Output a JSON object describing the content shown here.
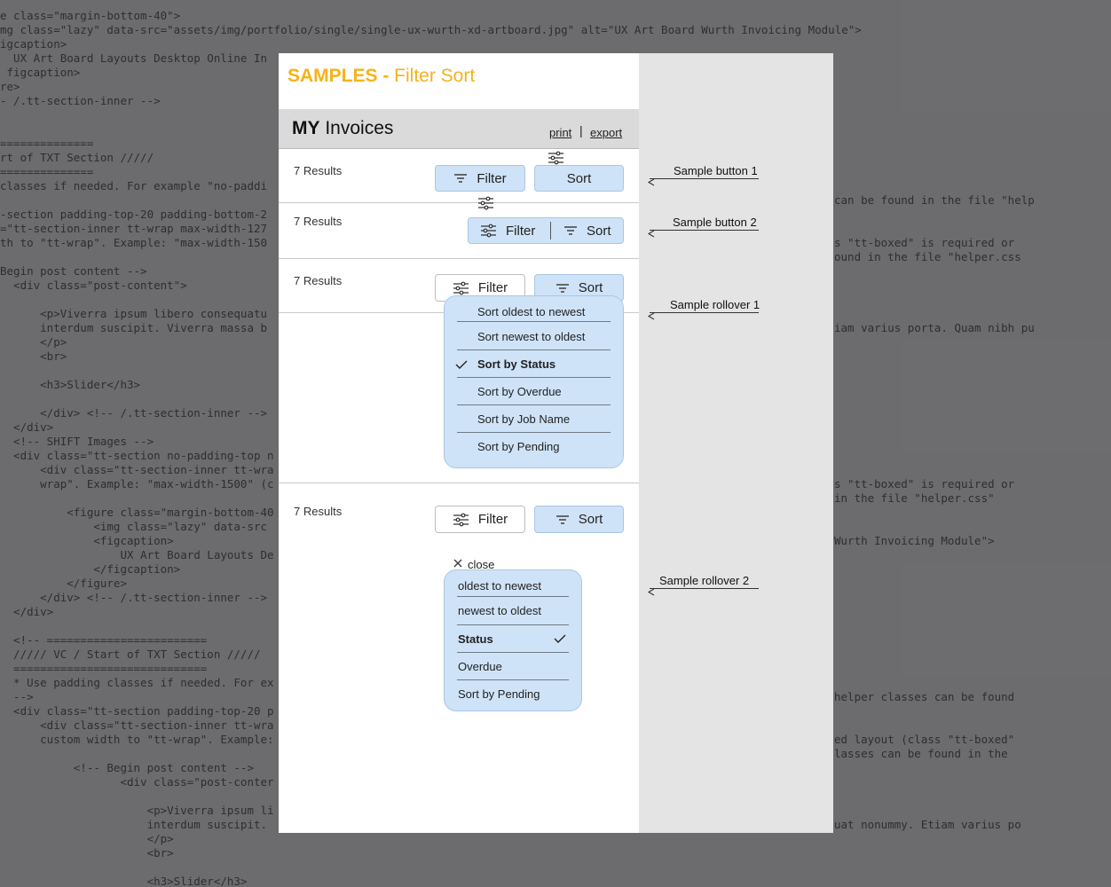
{
  "background_code": [
    "e class=\"margin-bottom-40\">",
    "mg class=\"lazy\" data-src=\"assets/img/portfolio/single/single-ux-wurth-xd-artboard.jpg\" alt=\"UX Art Board Wurth Invoicing Module\">",
    "igcaption>",
    "  UX Art Board Layouts Desktop Online In",
    " figcaption>",
    "re>",
    "- /.tt-section-inner -->",
    "",
    "",
    "==============",
    "rt of TXT Section /////",
    "==============",
    "classes if needed. For example \"no-paddi",
    "",
    "-section padding-top-20 padding-bottom-2",
    "=\"tt-section-inner tt-wrap max-width-127",
    "th to \"tt-wrap\". Example: \"max-width-150",
    "",
    "Begin post content -->",
    "  <div class=\"post-content\">",
    "",
    "      <p>Viverra ipsum libero consequatu",
    "      interdum suscipit. Viverra massa b",
    "      </p>",
    "      <br>",
    "",
    "      <h3>Slider</h3>",
    "",
    "      </div> <!-- /.tt-section-inner -->",
    "  </div>",
    "  <!-- SHIFT Images -->",
    "  <div class=\"tt-section no-padding-top n",
    "      <div class=\"tt-section-inner tt-wra",
    "      wrap\". Example: \"max-width-1500\" (c",
    "",
    "          <figure class=\"margin-bottom-40",
    "              <img class=\"lazy\" data-src",
    "              <figcaption>",
    "                  UX Art Board Layouts De",
    "              </figcaption>",
    "          </figure>",
    "      </div> <!-- /.tt-section-inner -->",
    "  </div>",
    "",
    "  <!-- ========================",
    "  ///// VC / Start of TXT Section /////",
    "  =============================",
    "  * Use padding classes if needed. For ex",
    "  -->",
    "  <div class=\"tt-section padding-top-20 p",
    "      <div class=\"tt-section-inner tt-wra",
    "      custom width to \"tt-wrap\". Example:",
    "",
    "           <!-- Begin post content -->",
    "                  <div class=\"post-conter",
    "",
    "                      <p>Viverra ipsum li",
    "                      interdum suscipit.",
    "                      </p>",
    "                      <br>",
    "",
    "                      <h3>Slider</h3>"
  ],
  "background_code_right": [
    {
      "row": 13,
      "text": "can be found in the file \"help"
    },
    {
      "row": 16,
      "text": "s \"tt-boxed\" is required or"
    },
    {
      "row": 17,
      "text": "ound in the file \"helper.css"
    },
    {
      "row": 22,
      "text": "iam varius porta. Quam nibh pu"
    },
    {
      "row": 33,
      "text": "s \"tt-boxed\" is required or"
    },
    {
      "row": 34,
      "text": "in the file \"helper.css\""
    },
    {
      "row": 37,
      "text": "Wurth Invoicing Module\">"
    },
    {
      "row": 48,
      "text": "helper classes can be found"
    },
    {
      "row": 51,
      "text": "ed layout (class \"tt-boxed\""
    },
    {
      "row": 52,
      "text": "lasses can be found in the"
    },
    {
      "row": 57,
      "text": "uat nonummy. Etiam varius po"
    }
  ],
  "title": {
    "bold": "SAMPLES -",
    "rest": " Filter Sort"
  },
  "header": {
    "bold": "MY",
    "rest": " Invoices",
    "print": "print",
    "divider": "|",
    "export": "export"
  },
  "results_label": "7 Results",
  "buttons": {
    "filter": "Filter",
    "sort": "Sort"
  },
  "rollover1": {
    "items": [
      "Sort oldest to newest",
      "Sort newest to oldest",
      "Sort by Status",
      "Sort by Overdue",
      "Sort by Job Name",
      "Sort by Pending"
    ],
    "checked": "Sort by Status"
  },
  "rollover2": {
    "close_label": "close",
    "items": [
      "oldest to newest",
      "newest to oldest",
      "Status",
      "Overdue",
      "Sort by Pending"
    ],
    "checked": "Status"
  },
  "annotations": [
    "Sample button 1",
    "Sample button 2",
    "Sample rollover 1",
    "Sample rollover 2"
  ],
  "icons": {
    "filter": "sliders-icon",
    "sort": "sort-lines-icon",
    "check": "check-icon",
    "close": "close-icon",
    "arrow": "arrow-left-icon"
  },
  "colors": {
    "accent": "#f5b21a",
    "button_fill": "#cfe3f8",
    "button_border": "#a9c5e4",
    "header_bar": "#dadada",
    "side_panel": "#e4e4e4"
  }
}
